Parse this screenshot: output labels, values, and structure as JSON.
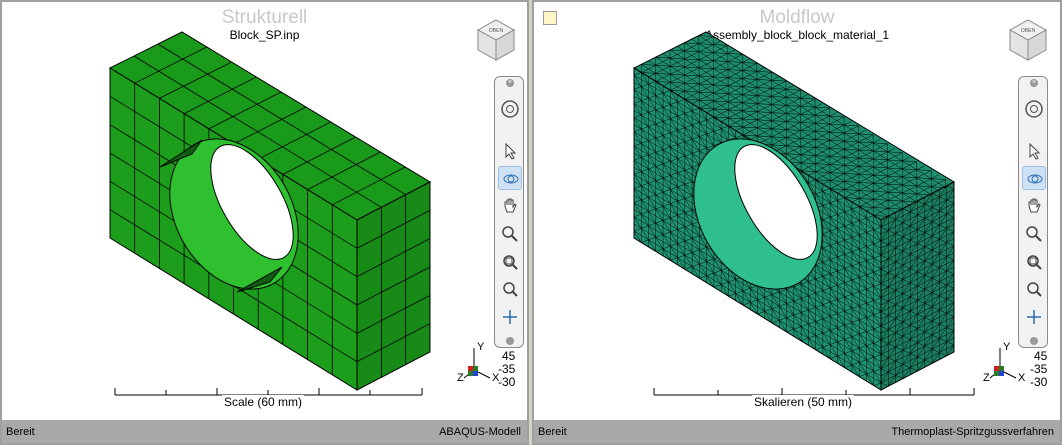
{
  "left_pane": {
    "title": "Strukturell",
    "subtitle": "Block_SP.inp",
    "scale_label": "Scale (60 mm)",
    "angles": [
      "45",
      "-35",
      "-30"
    ],
    "axis_labels": {
      "y": "Y",
      "z": "Z",
      "x": "X"
    },
    "status_left": "Bereit",
    "status_right": "ABAQUS-Modell",
    "mesh_color": "#1a9a1a",
    "hole_color": "#33cc33"
  },
  "right_pane": {
    "title": "Moldflow",
    "subtitle": "Assembly_block_block_material_1",
    "scale_label": "Skalieren (50 mm)",
    "angles": [
      "45",
      "-35",
      "-30"
    ],
    "axis_labels": {
      "y": "Y",
      "z": "Z",
      "x": "X"
    },
    "status_left": "Bereit",
    "status_right": "Thermoplast-Spritzgussverfahren",
    "mesh_color": "#1e8f6e",
    "hole_color": "#2fbf8f"
  },
  "toolbar_tools": [
    "steeringwheel-icon",
    "select-icon",
    "orbit-icon",
    "pan-icon",
    "zoom-icon",
    "zoom-window-icon",
    "zoom-extents-icon",
    "center-icon"
  ],
  "viewcube_faces": {
    "front": "VORNE",
    "right": "RECHTS",
    "top": "OBEN"
  }
}
